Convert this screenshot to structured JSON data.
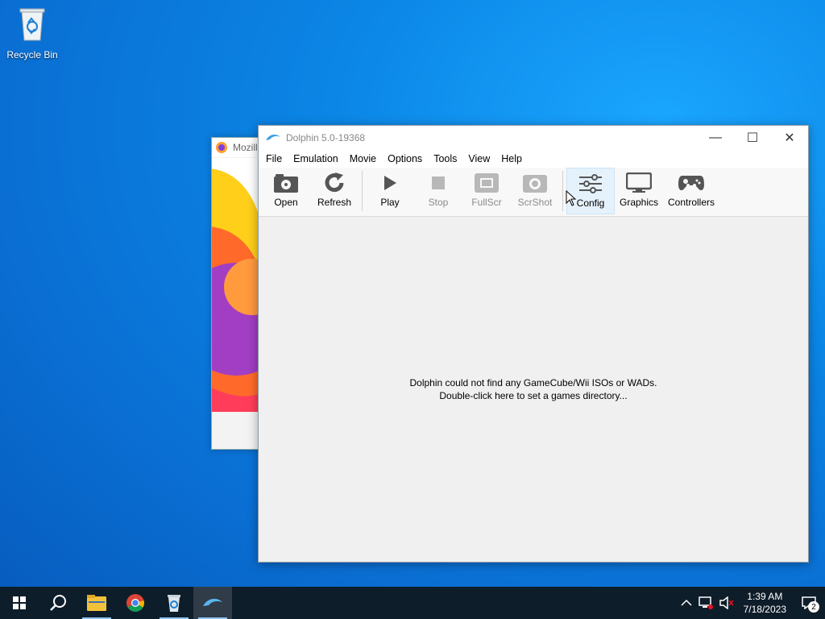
{
  "desktop": {
    "icons": [
      {
        "label": "Recycle Bin",
        "icon": "recycle-bin-icon"
      }
    ]
  },
  "background_window": {
    "title": "Mozill",
    "icon": "firefox-icon"
  },
  "window": {
    "title": "Dolphin 5.0-19368",
    "controls": {
      "minimize": "—",
      "maximize": "☐",
      "close": "✕"
    },
    "menu": [
      "File",
      "Emulation",
      "Movie",
      "Options",
      "Tools",
      "View",
      "Help"
    ],
    "toolbar": [
      {
        "label": "Open",
        "icon": "folder-open-icon",
        "enabled": true
      },
      {
        "label": "Refresh",
        "icon": "refresh-icon",
        "enabled": true
      },
      {
        "label": "Play",
        "icon": "play-icon",
        "enabled": true
      },
      {
        "label": "Stop",
        "icon": "stop-icon",
        "enabled": false
      },
      {
        "label": "FullScr",
        "icon": "fullscreen-icon",
        "enabled": false
      },
      {
        "label": "ScrShot",
        "icon": "camera-icon",
        "enabled": false
      },
      {
        "label": "Config",
        "icon": "sliders-icon",
        "enabled": true,
        "hovered": true
      },
      {
        "label": "Graphics",
        "icon": "monitor-icon",
        "enabled": true
      },
      {
        "label": "Controllers",
        "icon": "gamepad-icon",
        "enabled": true
      }
    ],
    "empty_message": {
      "line1": "Dolphin could not find any GameCube/Wii ISOs or WADs.",
      "line2": "Double-click here to set a games directory..."
    }
  },
  "taskbar": {
    "items": [
      "start-icon",
      "search-icon",
      "file-explorer-icon",
      "chrome-icon",
      "recycle-app-icon",
      "dolphin-icon"
    ],
    "active_item": "dolphin-icon",
    "clock": {
      "time": "1:39 AM",
      "date": "7/18/2023"
    },
    "notification_count": "2"
  },
  "colors": {
    "accent": "#0b86e6",
    "taskbar": "#0e1d2a",
    "hover": "#e5f1fb"
  }
}
